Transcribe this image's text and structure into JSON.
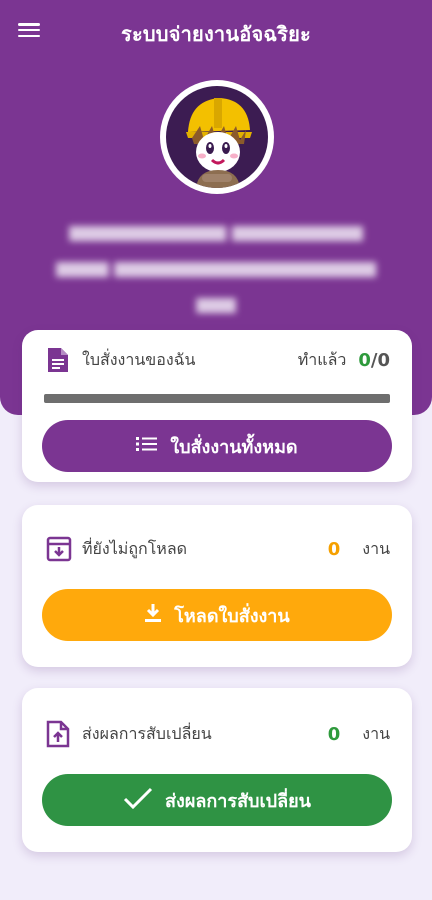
{
  "header": {
    "title": "ระบบจ่ายงานอัจฉริยะ"
  },
  "colors": {
    "primary": "#7b3592",
    "orange": "#ffa90c",
    "green": "#2f9344",
    "background": "#f1edfa"
  },
  "my_orders": {
    "label": "ใบสั่งงานของฉัน",
    "done_label": "ทำแล้ว",
    "done_count": "0",
    "separator": "/",
    "total_count": "0",
    "progress": 0,
    "button_label": "ใบสั่งงานทั้งหมด",
    "icon": "document-icon",
    "button_icon": "list-icon"
  },
  "not_downloaded": {
    "label": "ที่ยังไม่ถูกโหลด",
    "count": "0",
    "unit": "งาน",
    "button_label": "โหลดใบสั่งงาน",
    "icon": "archive-icon",
    "button_icon": "download-icon"
  },
  "exchange_results": {
    "label": "ส่งผลการสับเปลี่ยน",
    "count": "0",
    "unit": "งาน",
    "button_label": "ส่งผลการสับเปลี่ยน",
    "icon": "upload-file-icon",
    "button_icon": "check-icon"
  }
}
